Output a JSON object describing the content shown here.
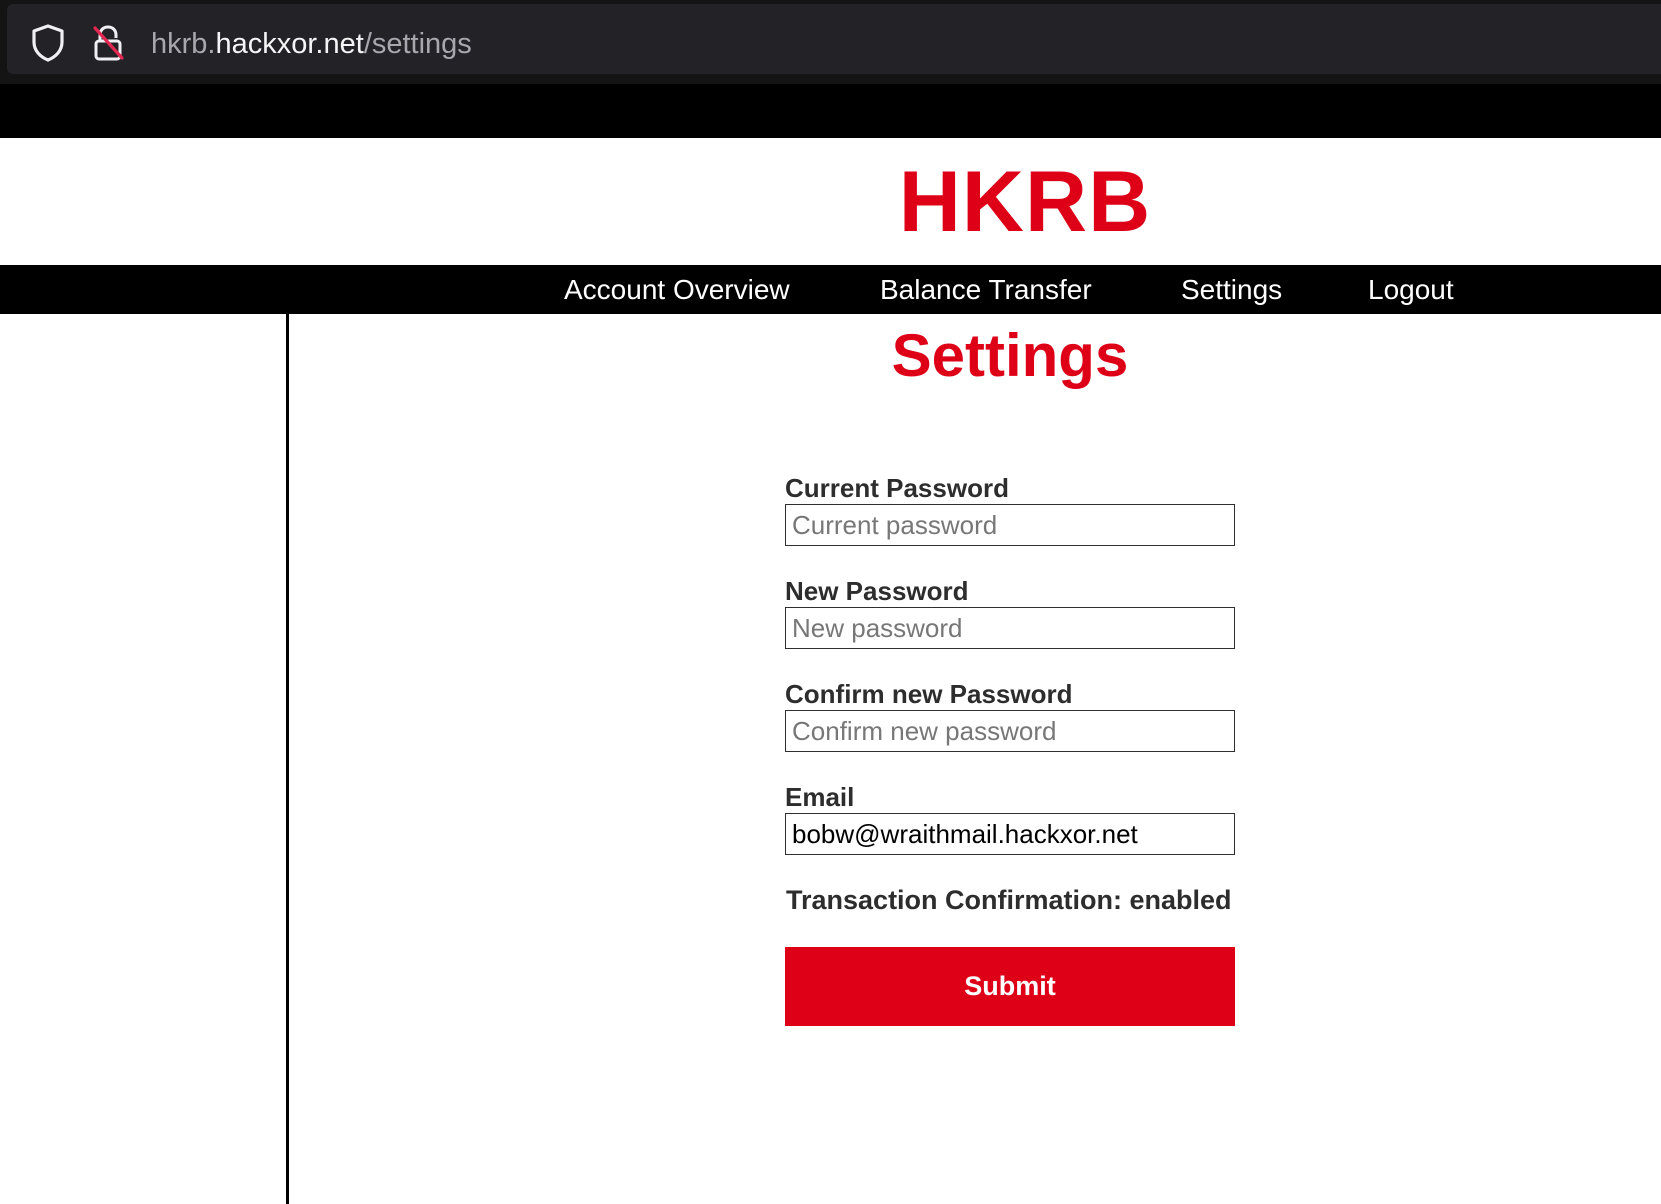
{
  "browser": {
    "url_subdomain": "hkrb.",
    "url_domain": "hackxor.net",
    "url_path": "/settings",
    "icons": [
      "shield-icon",
      "insecure-lock-icon"
    ]
  },
  "site": {
    "logo": "HKRB"
  },
  "nav": {
    "items": [
      {
        "label": "Account Overview"
      },
      {
        "label": "Balance Transfer"
      },
      {
        "label": "Settings"
      },
      {
        "label": "Logout"
      }
    ]
  },
  "page": {
    "title": "Settings"
  },
  "form": {
    "current_password": {
      "label": "Current Password",
      "placeholder": "Current password",
      "value": ""
    },
    "new_password": {
      "label": "New Password",
      "placeholder": "New password",
      "value": ""
    },
    "confirm_password": {
      "label": "Confirm new Password",
      "placeholder": "Confirm new password",
      "value": ""
    },
    "email": {
      "label": "Email",
      "placeholder": "",
      "value": "bobw@wraithmail.hackxor.net"
    },
    "transaction_confirmation": "Transaction Confirmation: enabled",
    "submit_label": "Submit"
  },
  "colors": {
    "brand_red": "#dd0017",
    "nav_background": "#000000",
    "browser_bar": "#222227"
  }
}
